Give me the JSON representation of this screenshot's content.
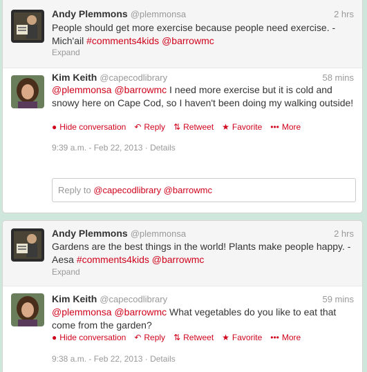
{
  "threads": [
    {
      "tweet1": {
        "name": "Andy Plemmons",
        "handle": "@plemmonsa",
        "time": "2 hrs",
        "text_plain": "People should get more exercise because people need exercise. -Mich'ail",
        "text_links": "#comments4kids @barrowmc",
        "expand": "Expand"
      },
      "tweet2": {
        "name": "Kim Keith",
        "handle": "@capecodlibrary",
        "time": "58 mins",
        "text_links": "@plemmonsa @barrowmc",
        "text_plain": "I need more exercise but it is cold and snowy here on Cape Cod, so I haven't been doing my walking outside!",
        "actions": {
          "hide": "Hide conversation",
          "reply": "Reply",
          "retweet": "Retweet",
          "favorite": "Favorite",
          "more": "More"
        },
        "meta_date": "9:39 a.m. - Feb 22, 2013",
        "meta_details": "Details"
      },
      "reply": {
        "prefix": "Reply to",
        "mentions": "@capecodlibrary @barrowmc"
      }
    },
    {
      "tweet1": {
        "name": "Andy Plemmons",
        "handle": "@plemmonsa",
        "time": "2 hrs",
        "text_plain": "Gardens are the best things in the world! Plants make people happy. -Aesa",
        "text_links": "#comments4kids @barrowmc",
        "expand": "Expand"
      },
      "tweet2": {
        "name": "Kim Keith",
        "handle": "@capecodlibrary",
        "time": "59 mins",
        "text_links": "@plemmonsa @barrowmc",
        "text_plain": "What vegetables do you like to eat that come from the garden?",
        "actions": {
          "hide": "Hide conversation",
          "reply": "Reply",
          "retweet": "Retweet",
          "favorite": "Favorite",
          "more": "More"
        },
        "meta_date": "9:38 a.m. - Feb 22, 2013",
        "meta_details": "Details"
      }
    }
  ],
  "colors": {
    "link": "#d0021b",
    "background": "#cfe6dc"
  },
  "icons": [
    "andy-avatar",
    "kim-avatar",
    "speech-bubble-icon",
    "reply-arrow-icon",
    "retweet-icon",
    "star-icon",
    "more-dots-icon"
  ]
}
